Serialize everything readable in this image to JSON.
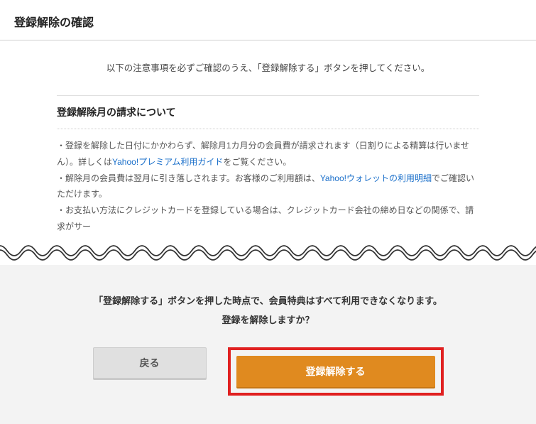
{
  "header": {
    "title": "登録解除の確認"
  },
  "intro": "以下の注意事項を必ずご確認のうえ、「登録解除する」ボタンを押してください。",
  "section": {
    "title": "登録解除月の請求について",
    "bullet1_pre": "・登録を解除した日付にかかわらず、解除月1カ月分の会員費が請求されます（日割りによる精算は行いません）。詳しくは",
    "bullet1_link": "Yahoo!プレミアム利用ガイド",
    "bullet1_post": "をご覧ください。",
    "bullet2_pre": "・解除月の会員費は翌月に引き落しされます。お客様のご利用額は、",
    "bullet2_link": "Yahoo!ウォレットの利用明細",
    "bullet2_post": "でご確認いただけます。",
    "bullet3": "・お支払い方法にクレジットカードを登録している場合は、クレジットカード会社の締め日などの関係で、請求がサー"
  },
  "footer": {
    "confirm1": "「登録解除する」ボタンを押した時点で、会員特典はすべて利用できなくなります。",
    "confirm2": "登録を解除しますか？",
    "back": "戻る",
    "unregister": "登録解除する"
  }
}
